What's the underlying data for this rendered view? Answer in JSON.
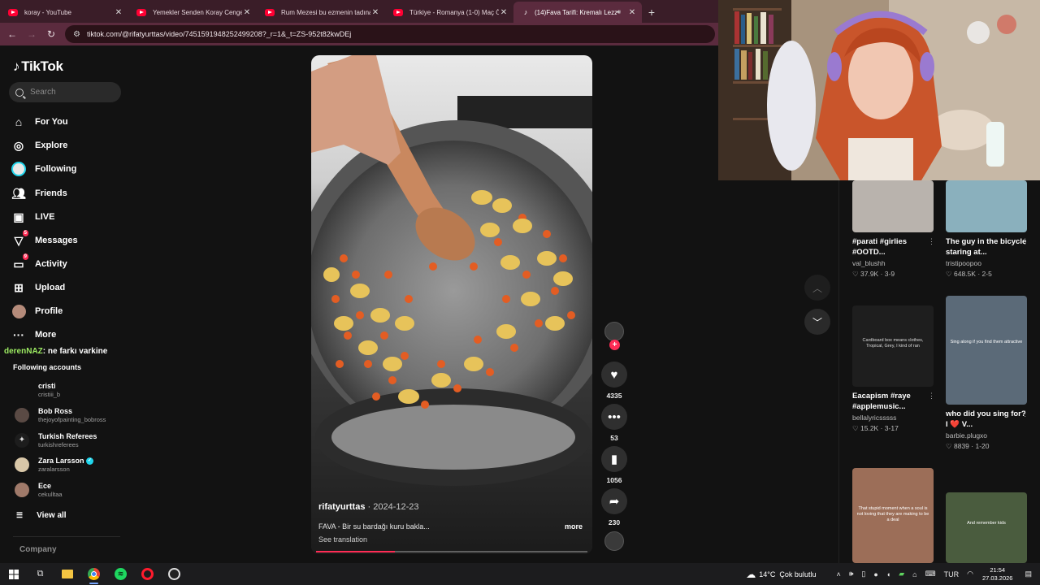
{
  "browser": {
    "tabs": [
      {
        "title": "koray - YouTube",
        "icon": "youtube-icon",
        "active": false
      },
      {
        "title": "Yemekler Senden Koray Cengel",
        "icon": "youtube-icon",
        "active": false
      },
      {
        "title": "Rum Mezesi bu ezmenin tadına",
        "icon": "youtube-icon",
        "active": false
      },
      {
        "title": "Türkiye - Romanya (1-0) Maç Ö",
        "icon": "youtube-icon",
        "active": false
      },
      {
        "title": "(14)Fava Tarifi: Kremalı Lezz",
        "icon": "tiktok-icon",
        "active": true
      }
    ],
    "url": "tiktok.com/@rifatyurttas/video/7451591948252499208?_r=1&_t=ZS-952t82kwDEj"
  },
  "tiktok": {
    "logo_text": "TikTok",
    "search_placeholder": "Search",
    "nav": [
      {
        "label": "For You",
        "icon": "home-icon",
        "badge": ""
      },
      {
        "label": "Explore",
        "icon": "compass-icon",
        "badge": ""
      },
      {
        "label": "Following",
        "icon": "following-avatar-icon",
        "badge": ""
      },
      {
        "label": "Friends",
        "icon": "friends-icon",
        "badge": ""
      },
      {
        "label": "LIVE",
        "icon": "live-icon",
        "badge": ""
      },
      {
        "label": "Messages",
        "icon": "messages-icon",
        "badge": "5"
      },
      {
        "label": "Activity",
        "icon": "activity-icon",
        "badge": "9"
      },
      {
        "label": "Upload",
        "icon": "upload-icon",
        "badge": ""
      },
      {
        "label": "Profile",
        "icon": "profile-avatar-icon",
        "badge": ""
      },
      {
        "label": "More",
        "icon": "more-icon",
        "badge": ""
      }
    ],
    "chat_overlay": {
      "user": "derenNAZ",
      "message": ": ne farkı varkine"
    },
    "following_title": "Following accounts",
    "following_accounts": [
      {
        "name": "cristi",
        "handle": "cristiii_b",
        "verified": false,
        "avatar_color": "#121212"
      },
      {
        "name": "Bob Ross",
        "handle": "thejoyofpainting_bobross",
        "verified": false,
        "avatar_color": "#5a4a44"
      },
      {
        "name": "Turkish Referees",
        "handle": "turkishreferees",
        "verified": false,
        "avatar_color": "#1d1d1d"
      },
      {
        "name": "Zara Larsson",
        "handle": "zaralarsson",
        "verified": true,
        "avatar_color": "#d9c7a8"
      },
      {
        "name": "Ece",
        "handle": "cekulltaa",
        "verified": false,
        "avatar_color": "#a07a6a"
      }
    ],
    "view_all": "View all",
    "company": "Company",
    "video": {
      "username": "rifatyurttas",
      "date": " · 2024-12-23",
      "caption": "FAVA - Bir su bardağı kuru bakla...",
      "more": "more",
      "see_translation": "See translation",
      "progress": 0.29
    },
    "actions": {
      "likes": "4335",
      "comments": "53",
      "saves": "1056",
      "shares": "230"
    },
    "related": [
      {
        "caption": "#parati #girlies #OOTD...",
        "author": "val_blushh",
        "likes": "37.9K",
        "duration": "3-9",
        "thumb_color": "#b9b3ad"
      },
      {
        "caption": "The guy in the bicycle staring at...",
        "author": "tristipoopoo",
        "likes": "648.5K",
        "duration": "2-5",
        "thumb_color": "#8ab0bd"
      },
      {
        "caption": "Eacapism #raye #applemusic...",
        "author": "bellalyricsssss",
        "likes": "15.2K",
        "duration": "3-17",
        "thumb_color": "#1e1e1e",
        "thumb_text": "Cardboard box means clothes, Tropical, Grey, I kind of ran"
      },
      {
        "caption": "who did you sing for? I ❤️ V...",
        "author": "barbie.plugxo",
        "likes": "8839",
        "duration": "1-20",
        "thumb_color": "#5b6a78",
        "thumb_text": "Sing along if you find them attractive"
      },
      {
        "caption": "",
        "author": "",
        "likes": "",
        "duration": "",
        "thumb_color": "#9c6e58",
        "thumb_text": "That stupid moment when a soul is not loving that they are making to be a deal"
      },
      {
        "caption": "",
        "author": "",
        "likes": "",
        "duration": "",
        "thumb_color": "#4a5c3e",
        "thumb_text": "And remember kids"
      }
    ]
  },
  "taskbar": {
    "weather_temp": "14°C",
    "weather_desc": "Çok bulutlu",
    "language": "TUR",
    "time": "21:54",
    "date": "27.03.2026"
  }
}
